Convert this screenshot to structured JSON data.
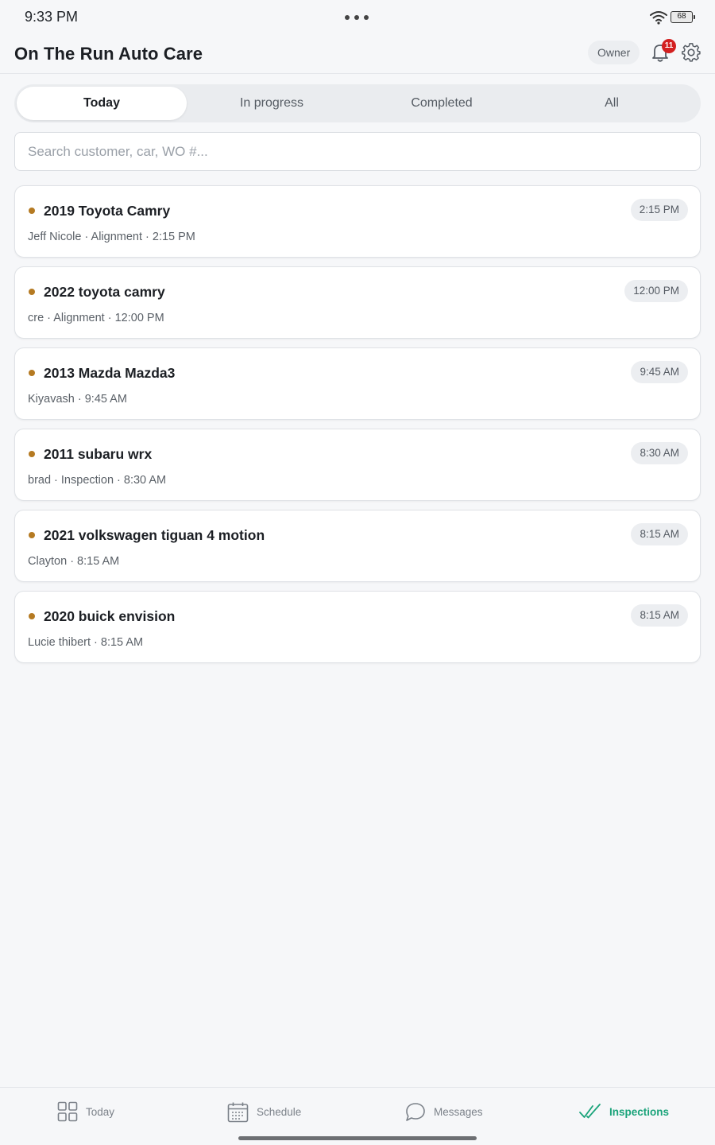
{
  "status_bar": {
    "time": "9:33 PM",
    "battery": "68"
  },
  "header": {
    "title": "On The Run Auto Care",
    "role": "Owner",
    "notification_count": "11"
  },
  "tabs": [
    {
      "label": "Today",
      "active": true
    },
    {
      "label": "In progress",
      "active": false
    },
    {
      "label": "Completed",
      "active": false
    },
    {
      "label": "All",
      "active": false
    }
  ],
  "search": {
    "placeholder": "Search customer, car, WO #...",
    "value": ""
  },
  "appointments": [
    {
      "vehicle": "2019 Toyota Camry",
      "details": "Jeff Nicole · Alignment · 2:15 PM",
      "time": "2:15 PM"
    },
    {
      "vehicle": "2022 toyota camry",
      "details": "cre · Alignment · 12:00 PM",
      "time": "12:00 PM"
    },
    {
      "vehicle": "2013 Mazda Mazda3",
      "details": "Kiyavash · 9:45 AM",
      "time": "9:45 AM"
    },
    {
      "vehicle": "2011 subaru wrx",
      "details": "brad · Inspection · 8:30 AM",
      "time": "8:30 AM"
    },
    {
      "vehicle": "2021 volkswagen tiguan 4 motion",
      "details": "Clayton · 8:15 AM",
      "time": "8:15 AM"
    },
    {
      "vehicle": "2020 buick envision",
      "details": "Lucie thibert · 8:15 AM",
      "time": "8:15 AM"
    }
  ],
  "bottom_nav": [
    {
      "label": "Today",
      "icon": "grid-icon",
      "active": false
    },
    {
      "label": "Schedule",
      "icon": "calendar-icon",
      "active": false
    },
    {
      "label": "Messages",
      "icon": "chat-icon",
      "active": false
    },
    {
      "label": "Inspections",
      "icon": "double-check-icon",
      "active": true
    }
  ],
  "colors": {
    "accent": "#1aa37a",
    "status_dot": "#b57a22",
    "badge_red": "#d32020"
  }
}
